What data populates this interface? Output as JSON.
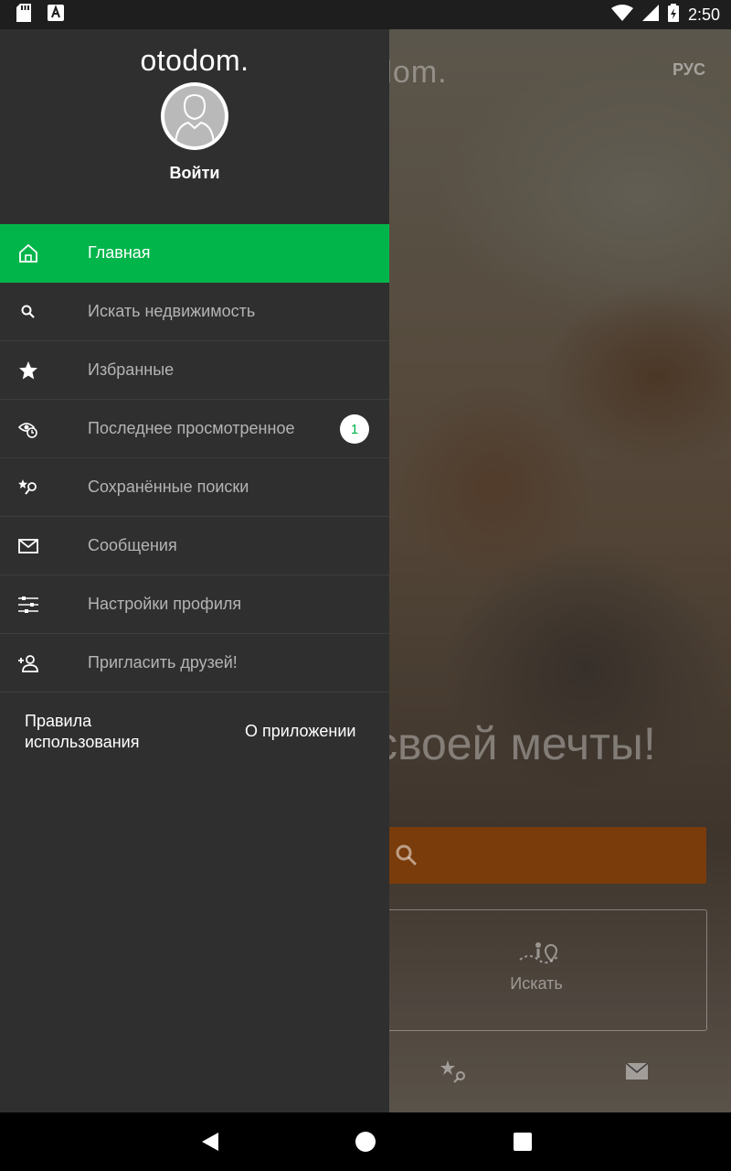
{
  "status_bar": {
    "time": "2:50",
    "icons": [
      "sd-card-icon",
      "notification-a-icon",
      "wifi-icon",
      "signal-icon",
      "battery-charging-icon"
    ]
  },
  "background": {
    "logo": "dom.",
    "language": "РУС",
    "headline": "своей мечты!",
    "search_box_label": "Искать",
    "bottom_icons": [
      "saved-searches-icon",
      "mail-icon"
    ]
  },
  "drawer": {
    "logo": "otodom.",
    "login_label": "Войти",
    "menu": [
      {
        "label": "Главная",
        "icon": "home-icon",
        "active": true
      },
      {
        "label": "Искать недвижимость",
        "icon": "search-icon"
      },
      {
        "label": "Избранные",
        "icon": "star-icon"
      },
      {
        "label": "Последнее просмотренное",
        "icon": "recently-viewed-icon",
        "badge": "1"
      },
      {
        "label": "Сохранённые поиски",
        "icon": "saved-searches-icon"
      },
      {
        "label": "Сообщения",
        "icon": "mail-icon"
      },
      {
        "label": "Настройки профиля",
        "icon": "settings-sliders-icon"
      },
      {
        "label": "Пригласить друзей!",
        "icon": "add-user-icon"
      }
    ],
    "footer": {
      "terms": "Правила использования",
      "about": "О приложении"
    }
  },
  "colors": {
    "accent": "#02b54b",
    "drawer_bg": "#2f2f2f",
    "search_bar": "#e8760f"
  }
}
